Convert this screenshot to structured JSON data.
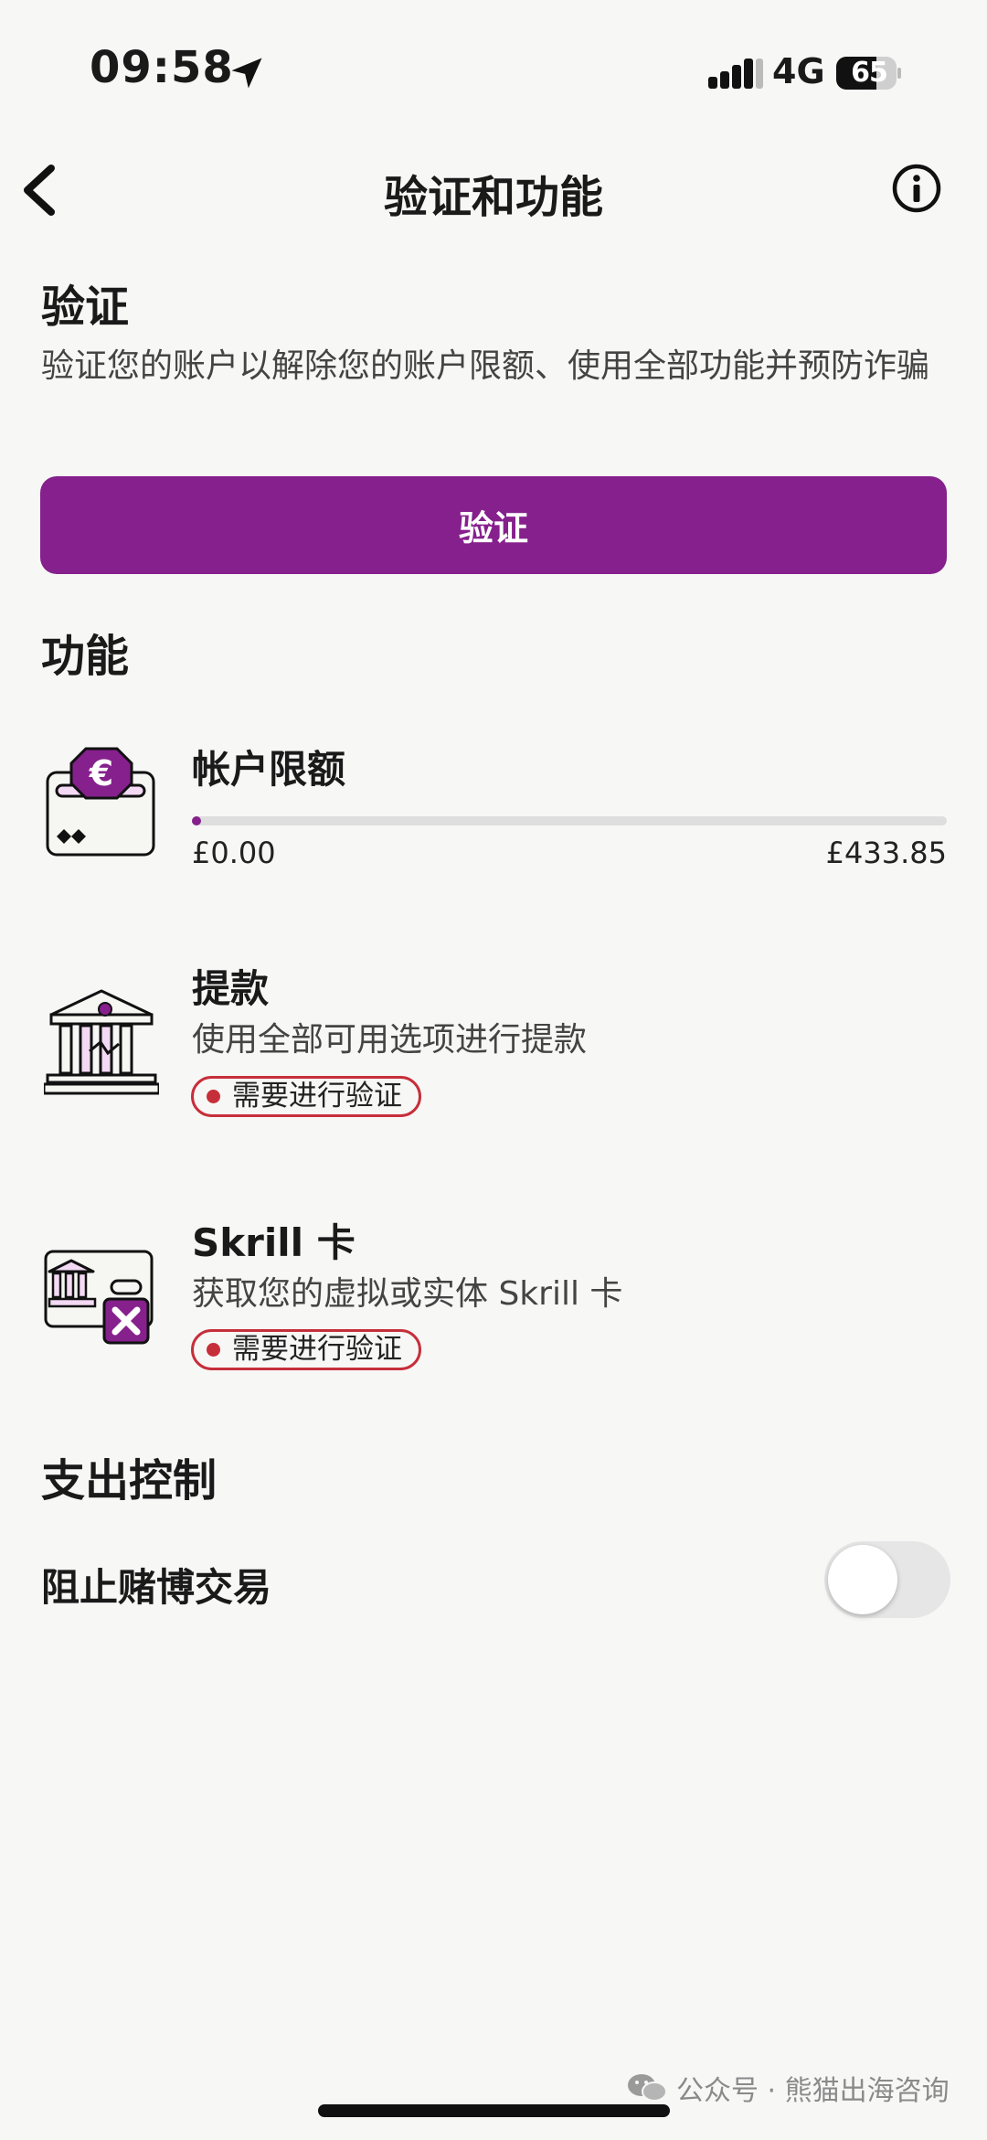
{
  "status_bar": {
    "time": "09:58",
    "network": "4G",
    "battery": "65"
  },
  "header": {
    "title": "验证和功能"
  },
  "verification": {
    "heading": "验证",
    "description": "验证您的账户以解除您的账户限额、使用全部功能并预防诈骗",
    "button_label": "验证"
  },
  "features": {
    "heading": "功能",
    "account_limit": {
      "title": "帐户限额",
      "min_label": "£0.00",
      "max_label": "£433.85",
      "progress_fraction": 0.0
    },
    "withdrawal": {
      "title": "提款",
      "description": "使用全部可用选项进行提款",
      "badge": "需要进行验证"
    },
    "skrill_card": {
      "title": "Skrill 卡",
      "description": "获取您的虚拟或实体 Skrill 卡",
      "badge": "需要进行验证"
    }
  },
  "spending_controls": {
    "heading": "支出控制",
    "block_gambling_label": "阻止赌博交易",
    "block_gambling_enabled": false
  },
  "watermark": "公众号 · 熊猫出海咨询",
  "colors": {
    "accent": "#85208c",
    "badge_red": "#c62f3a",
    "background": "#f7f7f6"
  },
  "icons": {
    "location": "location-arrow-icon",
    "back": "chevron-left-icon",
    "info": "info-circle-icon",
    "account_limit": "euro-wallet-icon",
    "withdrawal": "bank-icon",
    "skrill_card": "card-blocked-icon"
  }
}
